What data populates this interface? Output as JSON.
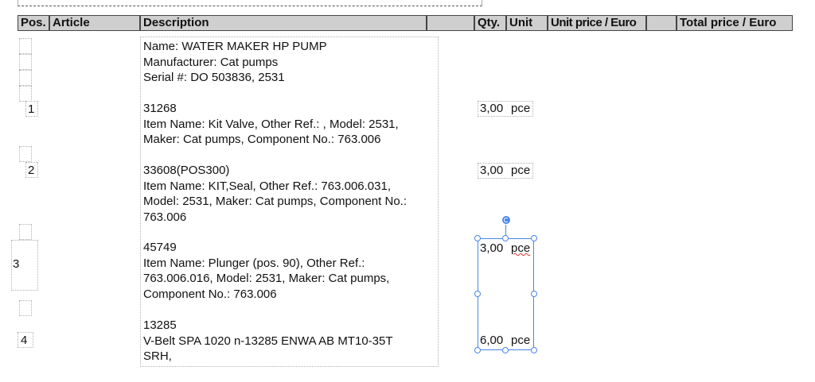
{
  "header": {
    "pos": "Pos.",
    "article": "Article",
    "description": "Description",
    "qty": "Qty.",
    "unit": "Unit",
    "unit_price": "Unit price / Euro",
    "total_price": "Total price / Euro"
  },
  "header_block": {
    "name": "Name: WATER MAKER HP PUMP",
    "manufacturer": "Manufacturer: Cat pumps",
    "serial": "Serial #: DO 503836, 2531"
  },
  "items": [
    {
      "pos": "1",
      "lines": [
        "31268",
        "Item Name: Kit Valve, Other Ref.: , Model: 2531,",
        "Maker: Cat pumps, Component No.: 763.006"
      ],
      "qty": "3,00",
      "unit": "pce"
    },
    {
      "pos": "2",
      "lines": [
        "33608(POS300)",
        "Item Name: KIT,Seal, Other Ref.: 763.006.031,",
        "Model: 2531, Maker: Cat pumps, Component No.:",
        "763.006"
      ],
      "qty": "3,00",
      "unit": "pce"
    },
    {
      "pos": "3",
      "lines": [
        "45749",
        "Item Name: Plunger (pos. 90), Other Ref.:",
        "763.006.016, Model: 2531, Maker: Cat pumps,",
        "Component No.: 763.006"
      ],
      "qty": "3,00",
      "unit": "pce"
    },
    {
      "pos": "4",
      "lines": [
        "13285",
        "V-Belt SPA 1020 n-13285 ENWA AB MT10-35T",
        "SRH,"
      ],
      "qty": "6,00",
      "unit": "pce"
    }
  ]
}
